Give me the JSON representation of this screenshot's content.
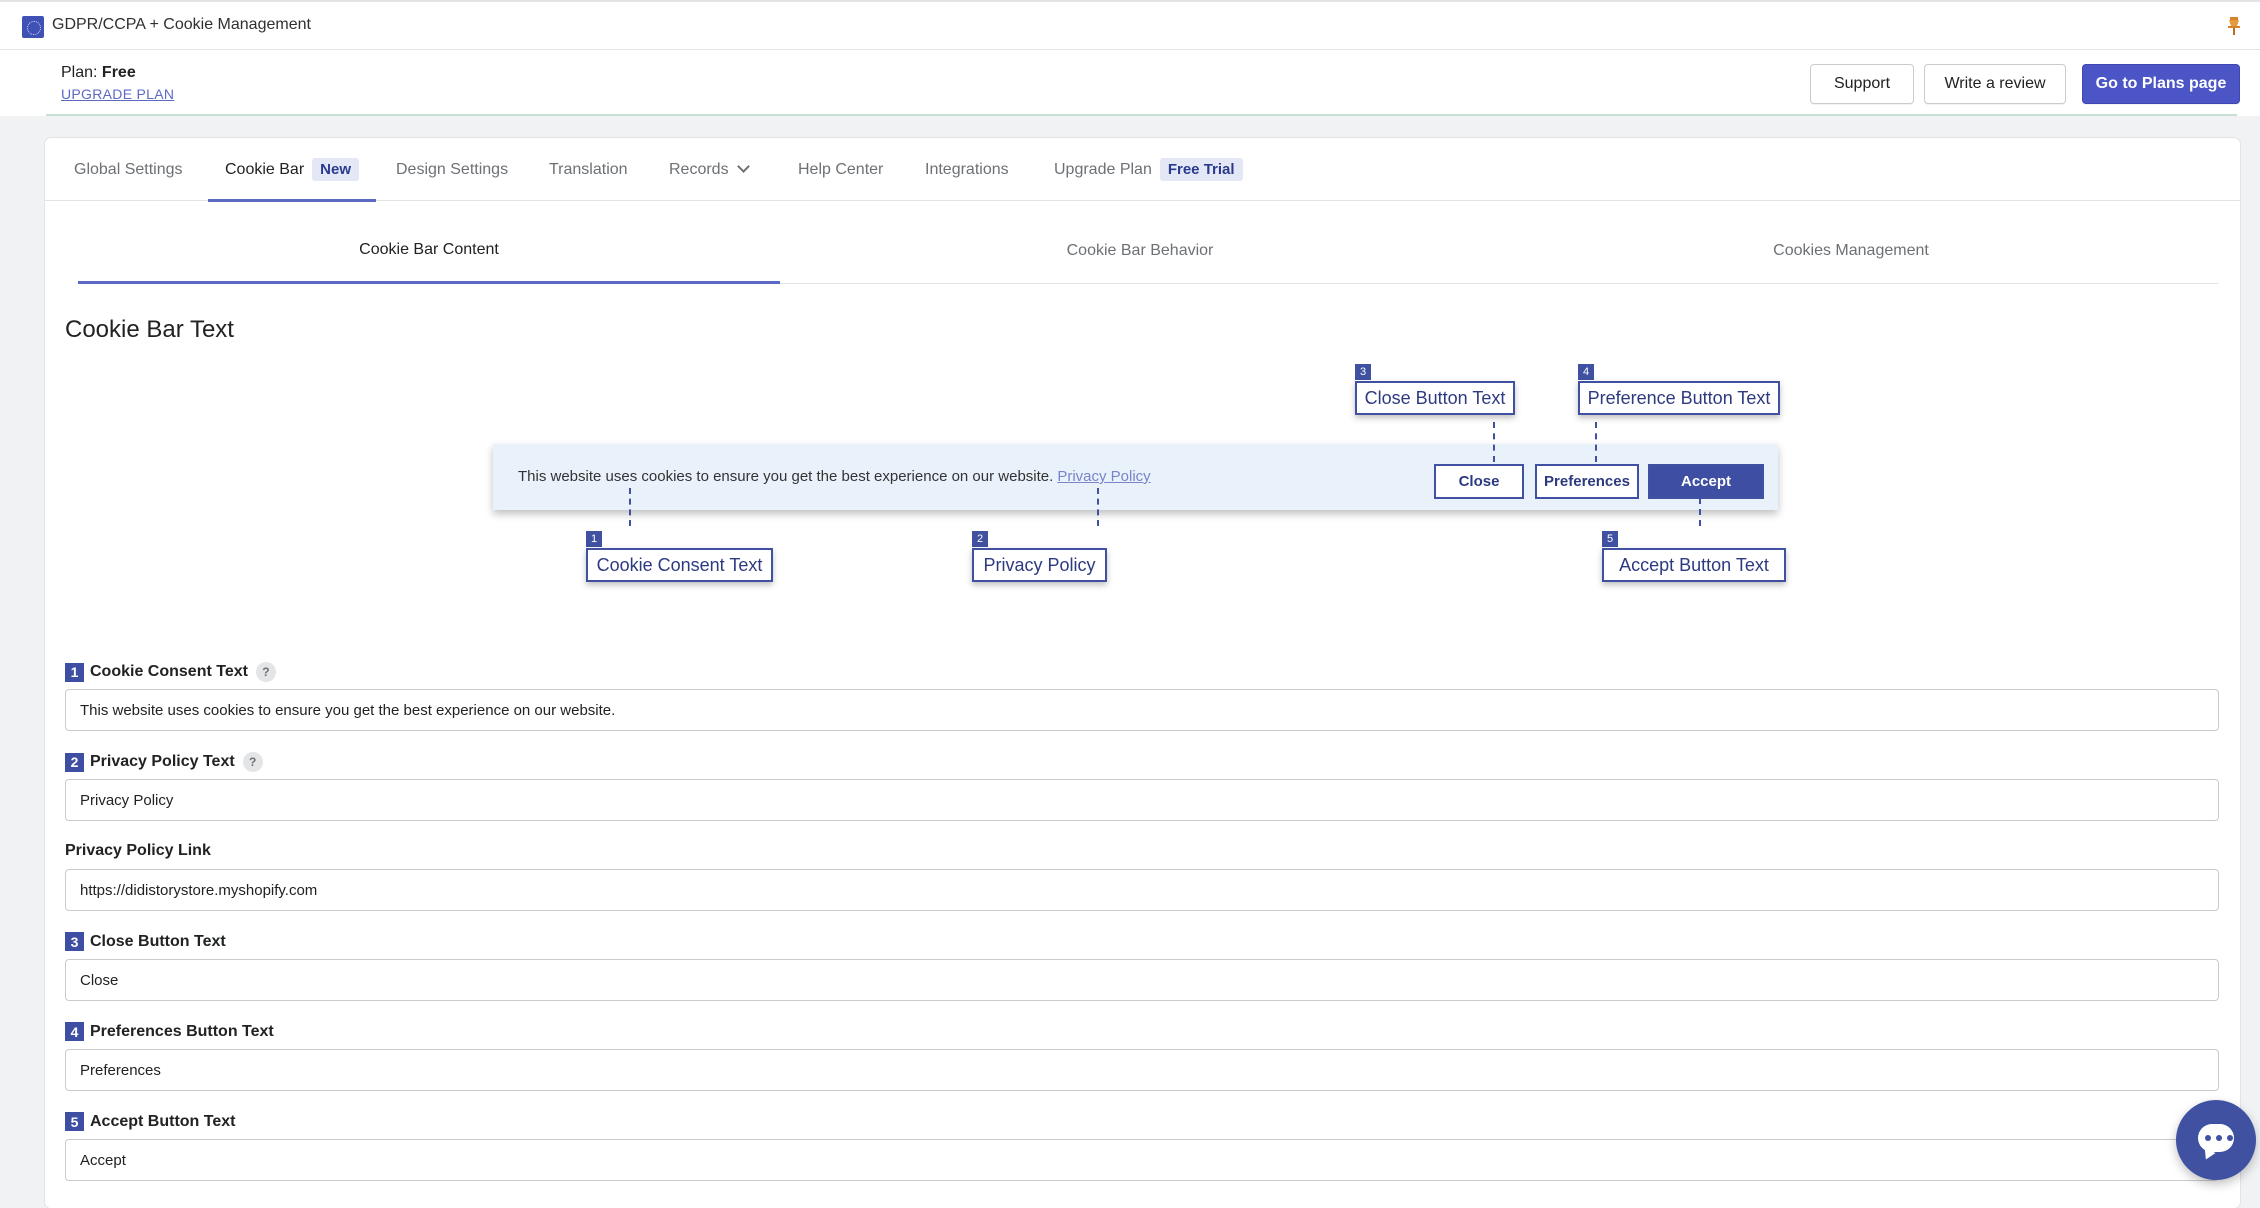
{
  "app": {
    "title": "GDPR/CCPA + Cookie Management"
  },
  "plan": {
    "label": "Plan:",
    "value": "Free",
    "upgrade": "UPGRADE PLAN"
  },
  "header_buttons": {
    "support": "Support",
    "review": "Write a review",
    "plans": "Go to Plans page"
  },
  "tabs": [
    {
      "label": "Global Settings"
    },
    {
      "label": "Cookie Bar",
      "badge": "New"
    },
    {
      "label": "Design Settings"
    },
    {
      "label": "Translation"
    },
    {
      "label": "Records"
    },
    {
      "label": "Help Center"
    },
    {
      "label": "Integrations"
    },
    {
      "label": "Upgrade Plan",
      "badge": "Free Trial"
    }
  ],
  "subtabs": [
    "Cookie Bar Content",
    "Cookie Bar Behavior",
    "Cookies Management"
  ],
  "section_title": "Cookie Bar Text",
  "preview": {
    "text": "This website uses cookies to ensure you get the best experience on our website.",
    "link": "Privacy Policy",
    "close": "Close",
    "preferences": "Preferences",
    "accept": "Accept"
  },
  "callouts": {
    "c1": {
      "num": "1",
      "label": "Cookie Consent Text"
    },
    "c2": {
      "num": "2",
      "label": "Privacy Policy"
    },
    "c3": {
      "num": "3",
      "label": "Close Button Text"
    },
    "c4": {
      "num": "4",
      "label": "Preference Button Text"
    },
    "c5": {
      "num": "5",
      "label": "Accept Button Text"
    }
  },
  "fields": {
    "consent": {
      "num": "1",
      "label": "Cookie Consent Text",
      "help": "?",
      "value": "This website uses cookies to ensure you get the best experience on our website."
    },
    "policy_text": {
      "num": "2",
      "label": "Privacy Policy Text",
      "help": "?",
      "value": "Privacy Policy"
    },
    "policy_link": {
      "label": "Privacy Policy Link",
      "value": "https://didistorystore.myshopify.com"
    },
    "close": {
      "num": "3",
      "label": "Close Button Text",
      "value": "Close"
    },
    "preferences": {
      "num": "4",
      "label": "Preferences Button Text",
      "value": "Preferences"
    },
    "accept": {
      "num": "5",
      "label": "Accept Button Text",
      "value": "Accept"
    }
  },
  "colors": {
    "accent": "#5c6ac4",
    "brand": "#3f51a0",
    "primary_button": "#4b55c6"
  },
  "icons": {
    "app": "app-logo-icon",
    "pin": "pin-icon",
    "records": "chevron-down-icon",
    "chat": "chat-icon"
  }
}
